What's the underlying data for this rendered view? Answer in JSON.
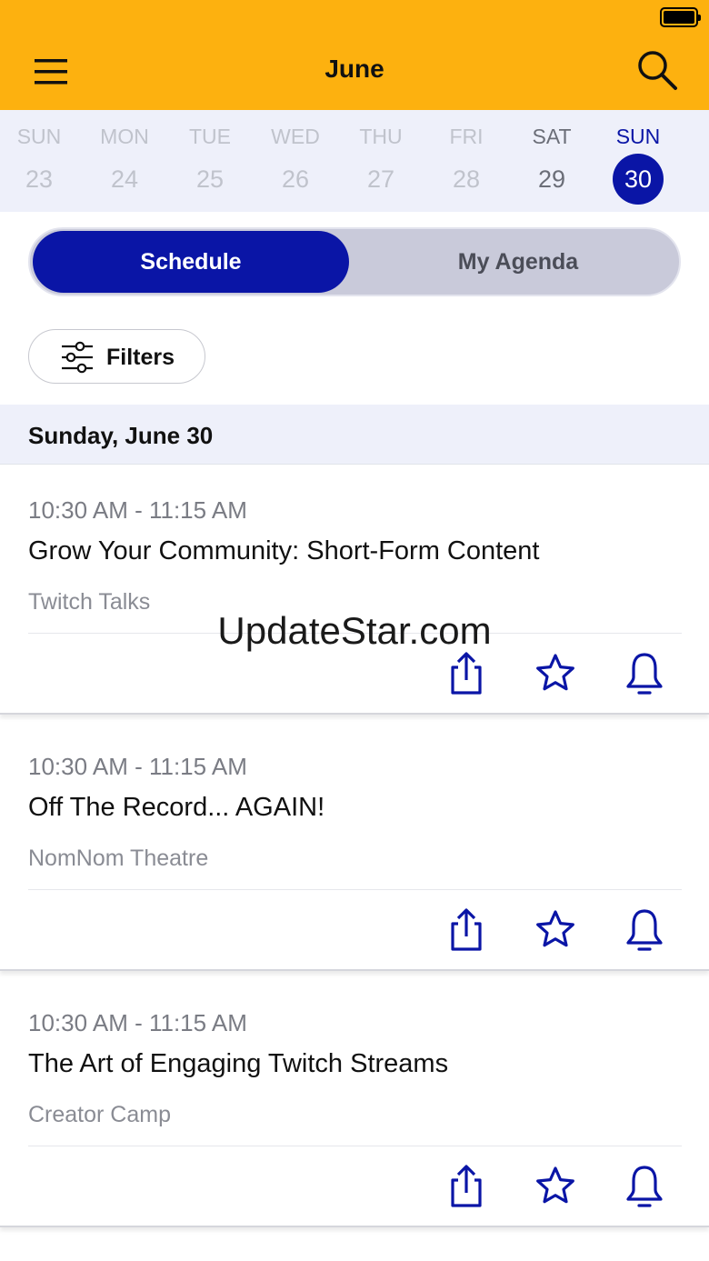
{
  "header": {
    "title": "June",
    "menu_icon": "hamburger-menu-icon",
    "search_icon": "search-icon",
    "background_color": "#FDB10F"
  },
  "week": [
    {
      "name": "SUN",
      "num": "23",
      "state": "disabled"
    },
    {
      "name": "MON",
      "num": "24",
      "state": "disabled"
    },
    {
      "name": "TUE",
      "num": "25",
      "state": "disabled"
    },
    {
      "name": "WED",
      "num": "26",
      "state": "disabled"
    },
    {
      "name": "THU",
      "num": "27",
      "state": "disabled"
    },
    {
      "name": "FRI",
      "num": "28",
      "state": "disabled"
    },
    {
      "name": "SAT",
      "num": "29",
      "state": "available"
    },
    {
      "name": "SUN",
      "num": "30",
      "state": "selected"
    }
  ],
  "tabs": {
    "schedule": "Schedule",
    "agenda": "My Agenda",
    "active": "schedule"
  },
  "filters": {
    "label": "Filters",
    "icon": "sliders-icon"
  },
  "date_header": "Sunday, June 30",
  "sessions": [
    {
      "time": "10:30 AM - 11:15 AM",
      "title": "Grow Your Community: Short-Form Content",
      "location": "Twitch Talks"
    },
    {
      "time": "10:30 AM - 11:15 AM",
      "title": "Off The Record... AGAIN!",
      "location": "NomNom Theatre"
    },
    {
      "time": "10:30 AM - 11:15 AM",
      "title": "The Art of Engaging Twitch Streams",
      "location": "Creator Camp"
    }
  ],
  "session_actions": [
    "share-icon",
    "star-icon",
    "bell-icon"
  ],
  "watermark": "UpdateStar.com",
  "colors": {
    "accent": "#0A15A6",
    "week_strip": "#EEF0FA",
    "segment_inactive": "#C9CADA"
  }
}
